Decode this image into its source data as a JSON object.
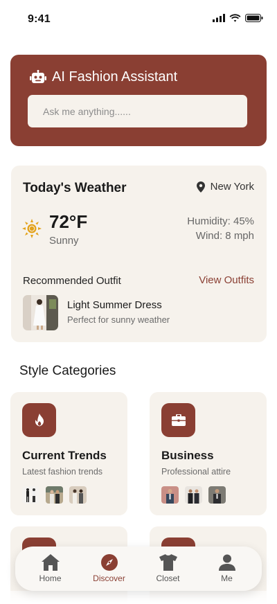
{
  "status": {
    "time": "9:41"
  },
  "assistant": {
    "title": "AI Fashion Assistant",
    "placeholder": "Ask me anything......",
    "icon": "robot-icon"
  },
  "weather": {
    "title": "Today's Weather",
    "location": "New York",
    "temperature": "72°F",
    "condition": "Sunny",
    "humidity": "Humidity: 45%",
    "wind": "Wind: 8 mph",
    "recommended_label": "Recommended Outfit",
    "view_link": "View Outfits",
    "outfit": {
      "name": "Light Summer Dress",
      "description": "Perfect for sunny weather"
    }
  },
  "categories": {
    "title": "Style Categories",
    "items": [
      {
        "title": "Current Trends",
        "subtitle": "Latest fashion trends",
        "icon": "flame-icon"
      },
      {
        "title": "Business",
        "subtitle": "Professional attire",
        "icon": "briefcase-icon"
      }
    ]
  },
  "nav": {
    "items": [
      {
        "label": "Home",
        "icon": "home-icon"
      },
      {
        "label": "Discover",
        "icon": "compass-icon",
        "active": true
      },
      {
        "label": "Closet",
        "icon": "shirt-icon"
      },
      {
        "label": "Me",
        "icon": "user-icon"
      }
    ]
  },
  "colors": {
    "accent": "#8a3f33",
    "card_bg": "#f6f2ec",
    "sun": "#e3a21a"
  }
}
